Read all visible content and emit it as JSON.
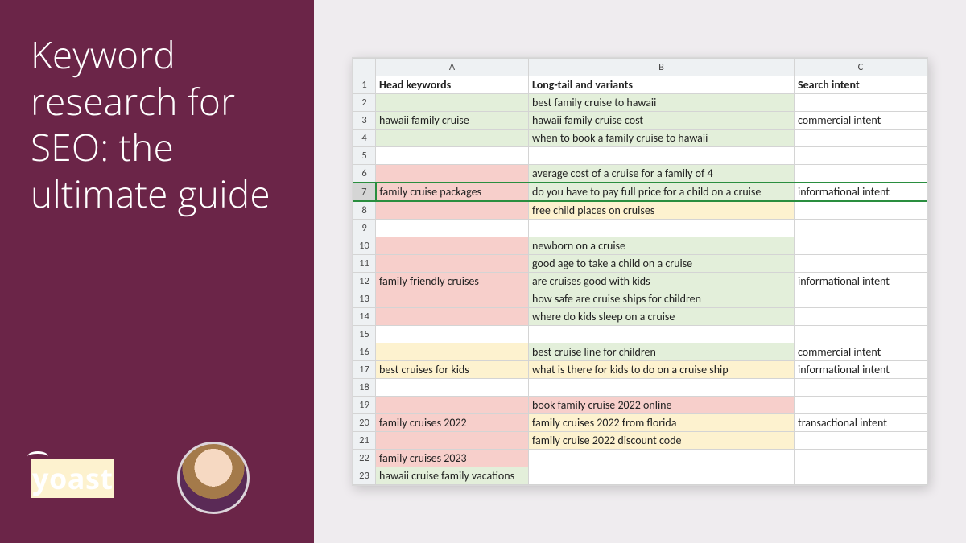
{
  "sidebar": {
    "title": "Keyword research for SEO: the ultimate guide",
    "logo_text": "yoast"
  },
  "sheet": {
    "columns": [
      "A",
      "B",
      "C"
    ],
    "headers": {
      "A": "Head keywords",
      "B": "Long-tail and variants",
      "C": "Search intent"
    },
    "selected_row": 7,
    "rows": [
      {
        "n": 1,
        "A": {
          "t": "_hdrA",
          "c": ""
        },
        "B": {
          "t": "_hdrB",
          "c": ""
        },
        "C": {
          "t": "_hdrC",
          "c": ""
        }
      },
      {
        "n": 2,
        "A": {
          "t": "",
          "c": "g"
        },
        "B": {
          "t": "best family cruise to hawaii",
          "c": "g"
        },
        "C": {
          "t": "",
          "c": ""
        }
      },
      {
        "n": 3,
        "A": {
          "t": "hawaii family cruise",
          "c": "g"
        },
        "B": {
          "t": "hawaii family cruise cost",
          "c": "g"
        },
        "C": {
          "t": "commercial intent",
          "c": ""
        }
      },
      {
        "n": 4,
        "A": {
          "t": "",
          "c": "g"
        },
        "B": {
          "t": "when to book a family cruise to hawaii",
          "c": "g"
        },
        "C": {
          "t": "",
          "c": ""
        }
      },
      {
        "n": 5,
        "A": {
          "t": "",
          "c": ""
        },
        "B": {
          "t": "",
          "c": ""
        },
        "C": {
          "t": "",
          "c": ""
        }
      },
      {
        "n": 6,
        "A": {
          "t": "",
          "c": "r"
        },
        "B": {
          "t": "average cost of a cruise for a family of 4",
          "c": "g"
        },
        "C": {
          "t": "",
          "c": ""
        }
      },
      {
        "n": 7,
        "A": {
          "t": "family cruise packages",
          "c": "r"
        },
        "B": {
          "t": "do you have to pay full price for a child on a cruise",
          "c": "g"
        },
        "C": {
          "t": "informational intent",
          "c": ""
        }
      },
      {
        "n": 8,
        "A": {
          "t": "",
          "c": "r"
        },
        "B": {
          "t": "free child places on cruises",
          "c": "y"
        },
        "C": {
          "t": "",
          "c": ""
        }
      },
      {
        "n": 9,
        "A": {
          "t": "",
          "c": ""
        },
        "B": {
          "t": "",
          "c": ""
        },
        "C": {
          "t": "",
          "c": ""
        }
      },
      {
        "n": 10,
        "A": {
          "t": "",
          "c": "r"
        },
        "B": {
          "t": "newborn on a cruise",
          "c": "g"
        },
        "C": {
          "t": "",
          "c": ""
        }
      },
      {
        "n": 11,
        "A": {
          "t": "",
          "c": "r"
        },
        "B": {
          "t": "good age to take a child on a cruise",
          "c": "g"
        },
        "C": {
          "t": "",
          "c": ""
        }
      },
      {
        "n": 12,
        "A": {
          "t": "family friendly cruises",
          "c": "r"
        },
        "B": {
          "t": "are cruises good with kids",
          "c": "g"
        },
        "C": {
          "t": "informational intent",
          "c": ""
        }
      },
      {
        "n": 13,
        "A": {
          "t": "",
          "c": "r"
        },
        "B": {
          "t": "how safe are cruise ships for children",
          "c": "g"
        },
        "C": {
          "t": "",
          "c": ""
        }
      },
      {
        "n": 14,
        "A": {
          "t": "",
          "c": "r"
        },
        "B": {
          "t": "where do kids sleep on a cruise",
          "c": "g"
        },
        "C": {
          "t": "",
          "c": ""
        }
      },
      {
        "n": 15,
        "A": {
          "t": "",
          "c": ""
        },
        "B": {
          "t": "",
          "c": ""
        },
        "C": {
          "t": "",
          "c": ""
        }
      },
      {
        "n": 16,
        "A": {
          "t": "",
          "c": "y"
        },
        "B": {
          "t": "best cruise line for children",
          "c": "g"
        },
        "C": {
          "t": "commercial intent",
          "c": ""
        }
      },
      {
        "n": 17,
        "A": {
          "t": "best cruises for kids",
          "c": "y"
        },
        "B": {
          "t": "what is there for kids to do on a cruise ship",
          "c": "y"
        },
        "C": {
          "t": "informational intent",
          "c": ""
        }
      },
      {
        "n": 18,
        "A": {
          "t": "",
          "c": ""
        },
        "B": {
          "t": "",
          "c": ""
        },
        "C": {
          "t": "",
          "c": ""
        }
      },
      {
        "n": 19,
        "A": {
          "t": "",
          "c": "r"
        },
        "B": {
          "t": "book family cruise 2022 online",
          "c": "r"
        },
        "C": {
          "t": "",
          "c": ""
        }
      },
      {
        "n": 20,
        "A": {
          "t": "family cruises 2022",
          "c": "r"
        },
        "B": {
          "t": "family cruises 2022 from florida",
          "c": "y"
        },
        "C": {
          "t": "transactional intent",
          "c": ""
        }
      },
      {
        "n": 21,
        "A": {
          "t": "",
          "c": "r"
        },
        "B": {
          "t": "family cruise 2022 discount code",
          "c": "y"
        },
        "C": {
          "t": "",
          "c": ""
        }
      },
      {
        "n": 22,
        "A": {
          "t": "family cruises 2023",
          "c": "r"
        },
        "B": {
          "t": "",
          "c": ""
        },
        "C": {
          "t": "",
          "c": ""
        }
      },
      {
        "n": 23,
        "A": {
          "t": "hawaii cruise family vacations",
          "c": "g"
        },
        "B": {
          "t": "",
          "c": ""
        },
        "C": {
          "t": "",
          "c": ""
        }
      }
    ]
  }
}
